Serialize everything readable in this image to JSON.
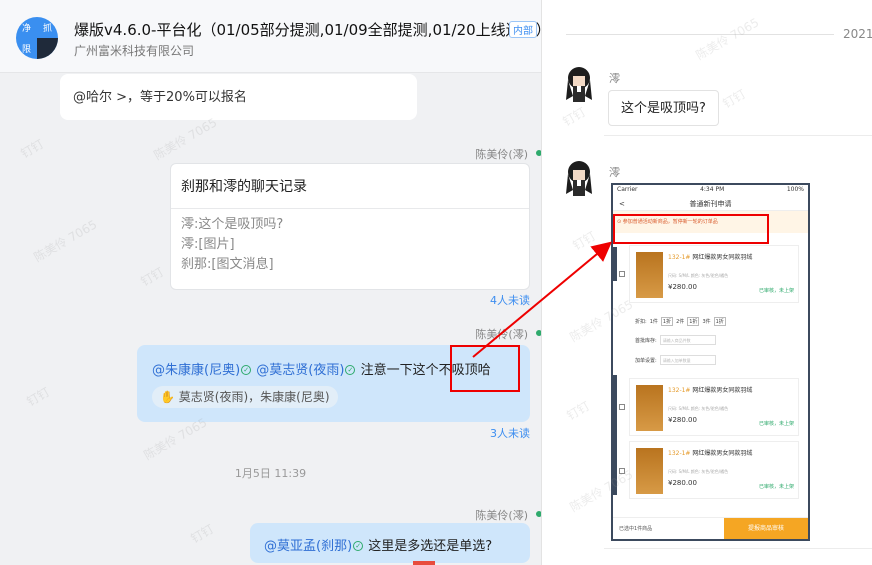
{
  "chat": {
    "avatar_text": [
      "净",
      "抓",
      "限",
      ""
    ],
    "title": "爆版v4.6.0-平台化（01/05部分提测,01/09全部提测,01/20上线送审）",
    "badge": "内部",
    "subtitle": "广州富米科技有限公司"
  },
  "messages": {
    "m1_text": "@哈尔 >，等于20%可以报名",
    "m2_sender": "陈美伶(澪)",
    "m2_card_title": "刹那和澪的聊天记录",
    "m2_lines": [
      "澪:这个是吸顶吗?",
      "澪:[图片]",
      "刹那:[图文消息]"
    ],
    "m2_unread": "4人未读",
    "m3_sender": "陈美伶(澪)",
    "m3_mention1": "@朱康康(尼奥)",
    "m3_mention2": "@莫志贤(夜雨)",
    "m3_text_a": "注意一下这个",
    "m3_text_b": "不吸顶哈",
    "m3_tags": "莫志贤(夜雨)，朱康康(尼奥)",
    "m3_unread": "3人未读",
    "time_divider": "1月5日 11:39",
    "m4_sender": "陈美伶(澪)",
    "m4_mention": "@莫亚孟(刹那)",
    "m4_text": "这里是多选还是单选?"
  },
  "record": {
    "date": "2021",
    "sender1": "澪",
    "msg1": "这个是吸顶吗?",
    "sender2": "澪"
  },
  "phone": {
    "carrier": "Carrier",
    "time": "4:34 PM",
    "battery": "100%",
    "nav_title": "普通新刊申请",
    "back": "<",
    "warning": "参加普通活动新商品，暂停新一轮的订单品",
    "item_name_code": "132-1#",
    "item_name": "网红爆款男女同款羽绒",
    "item_spec": "尺码: S/M/L   颜色: 灰色/驼色/橘色",
    "item_price": "¥280.00",
    "item_status1": "已审核，未上架",
    "item_status2": "已审核，未上架",
    "row1": [
      "折扣:",
      "1件",
      "1折",
      "2件",
      "1折",
      "3件",
      "1折"
    ],
    "row2_label": "首批库存:",
    "row2_ph": "请输入商品件数",
    "row3_label": "加单设置:",
    "row3_ph": "请输入加单数量",
    "bottom_count": "已选中1件商品",
    "bottom_button": "提报商品审核"
  },
  "watermark": [
    "陈美伶 7065",
    "钉钉"
  ],
  "colors": {
    "accent": "#3d8ef0",
    "bubble_self": "#cfe6fb",
    "annotation": "#e00000"
  }
}
